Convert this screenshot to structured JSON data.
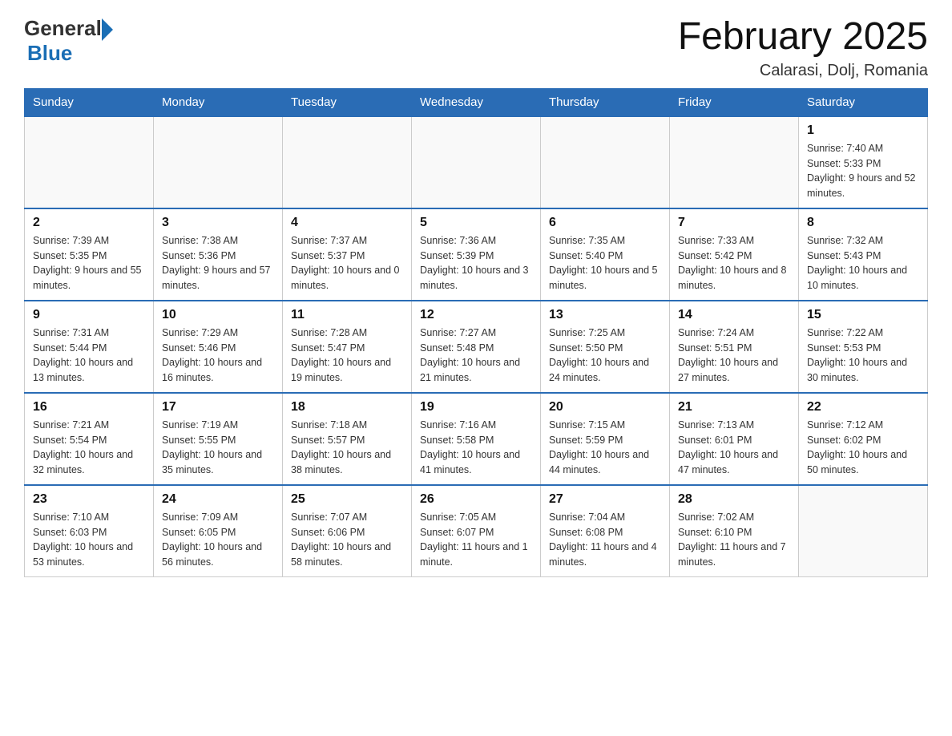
{
  "header": {
    "logo_general": "General",
    "logo_blue": "Blue",
    "month_title": "February 2025",
    "location": "Calarasi, Dolj, Romania"
  },
  "days_of_week": [
    "Sunday",
    "Monday",
    "Tuesday",
    "Wednesday",
    "Thursday",
    "Friday",
    "Saturday"
  ],
  "weeks": [
    [
      {
        "day": "",
        "info": ""
      },
      {
        "day": "",
        "info": ""
      },
      {
        "day": "",
        "info": ""
      },
      {
        "day": "",
        "info": ""
      },
      {
        "day": "",
        "info": ""
      },
      {
        "day": "",
        "info": ""
      },
      {
        "day": "1",
        "info": "Sunrise: 7:40 AM\nSunset: 5:33 PM\nDaylight: 9 hours and 52 minutes."
      }
    ],
    [
      {
        "day": "2",
        "info": "Sunrise: 7:39 AM\nSunset: 5:35 PM\nDaylight: 9 hours and 55 minutes."
      },
      {
        "day": "3",
        "info": "Sunrise: 7:38 AM\nSunset: 5:36 PM\nDaylight: 9 hours and 57 minutes."
      },
      {
        "day": "4",
        "info": "Sunrise: 7:37 AM\nSunset: 5:37 PM\nDaylight: 10 hours and 0 minutes."
      },
      {
        "day": "5",
        "info": "Sunrise: 7:36 AM\nSunset: 5:39 PM\nDaylight: 10 hours and 3 minutes."
      },
      {
        "day": "6",
        "info": "Sunrise: 7:35 AM\nSunset: 5:40 PM\nDaylight: 10 hours and 5 minutes."
      },
      {
        "day": "7",
        "info": "Sunrise: 7:33 AM\nSunset: 5:42 PM\nDaylight: 10 hours and 8 minutes."
      },
      {
        "day": "8",
        "info": "Sunrise: 7:32 AM\nSunset: 5:43 PM\nDaylight: 10 hours and 10 minutes."
      }
    ],
    [
      {
        "day": "9",
        "info": "Sunrise: 7:31 AM\nSunset: 5:44 PM\nDaylight: 10 hours and 13 minutes."
      },
      {
        "day": "10",
        "info": "Sunrise: 7:29 AM\nSunset: 5:46 PM\nDaylight: 10 hours and 16 minutes."
      },
      {
        "day": "11",
        "info": "Sunrise: 7:28 AM\nSunset: 5:47 PM\nDaylight: 10 hours and 19 minutes."
      },
      {
        "day": "12",
        "info": "Sunrise: 7:27 AM\nSunset: 5:48 PM\nDaylight: 10 hours and 21 minutes."
      },
      {
        "day": "13",
        "info": "Sunrise: 7:25 AM\nSunset: 5:50 PM\nDaylight: 10 hours and 24 minutes."
      },
      {
        "day": "14",
        "info": "Sunrise: 7:24 AM\nSunset: 5:51 PM\nDaylight: 10 hours and 27 minutes."
      },
      {
        "day": "15",
        "info": "Sunrise: 7:22 AM\nSunset: 5:53 PM\nDaylight: 10 hours and 30 minutes."
      }
    ],
    [
      {
        "day": "16",
        "info": "Sunrise: 7:21 AM\nSunset: 5:54 PM\nDaylight: 10 hours and 32 minutes."
      },
      {
        "day": "17",
        "info": "Sunrise: 7:19 AM\nSunset: 5:55 PM\nDaylight: 10 hours and 35 minutes."
      },
      {
        "day": "18",
        "info": "Sunrise: 7:18 AM\nSunset: 5:57 PM\nDaylight: 10 hours and 38 minutes."
      },
      {
        "day": "19",
        "info": "Sunrise: 7:16 AM\nSunset: 5:58 PM\nDaylight: 10 hours and 41 minutes."
      },
      {
        "day": "20",
        "info": "Sunrise: 7:15 AM\nSunset: 5:59 PM\nDaylight: 10 hours and 44 minutes."
      },
      {
        "day": "21",
        "info": "Sunrise: 7:13 AM\nSunset: 6:01 PM\nDaylight: 10 hours and 47 minutes."
      },
      {
        "day": "22",
        "info": "Sunrise: 7:12 AM\nSunset: 6:02 PM\nDaylight: 10 hours and 50 minutes."
      }
    ],
    [
      {
        "day": "23",
        "info": "Sunrise: 7:10 AM\nSunset: 6:03 PM\nDaylight: 10 hours and 53 minutes."
      },
      {
        "day": "24",
        "info": "Sunrise: 7:09 AM\nSunset: 6:05 PM\nDaylight: 10 hours and 56 minutes."
      },
      {
        "day": "25",
        "info": "Sunrise: 7:07 AM\nSunset: 6:06 PM\nDaylight: 10 hours and 58 minutes."
      },
      {
        "day": "26",
        "info": "Sunrise: 7:05 AM\nSunset: 6:07 PM\nDaylight: 11 hours and 1 minute."
      },
      {
        "day": "27",
        "info": "Sunrise: 7:04 AM\nSunset: 6:08 PM\nDaylight: 11 hours and 4 minutes."
      },
      {
        "day": "28",
        "info": "Sunrise: 7:02 AM\nSunset: 6:10 PM\nDaylight: 11 hours and 7 minutes."
      },
      {
        "day": "",
        "info": ""
      }
    ]
  ]
}
